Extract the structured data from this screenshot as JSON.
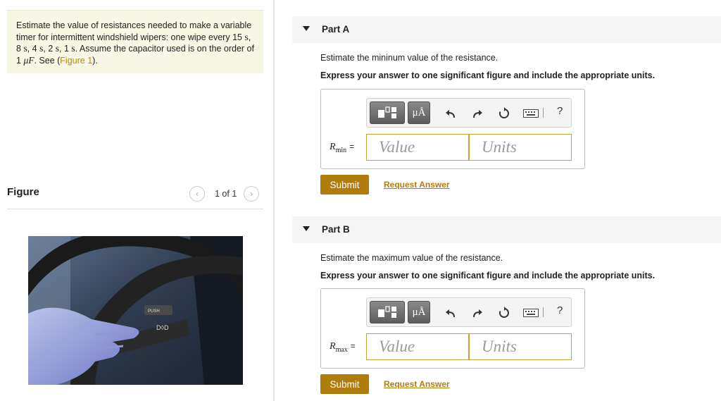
{
  "problem": {
    "text_1": "Estimate the value of resistances needed to make a variable timer for intermittent windshield wipers: one wipe every 15",
    "unit_s": "s",
    "v2": "8",
    "v3": "4",
    "v4": "2",
    "v5": "1",
    "text_2": ". Assume the capacitor used is on the order of 1",
    "unit_uF": "μF",
    "text_3": ". See (",
    "figure_link": "Figure 1",
    "text_4": ")."
  },
  "figure": {
    "title": "Figure",
    "pager": "1 of 1",
    "prev_glyph": "‹",
    "next_glyph": "›"
  },
  "toolbar": {
    "mu_a_label": "μÅ",
    "help_label": "?",
    "icons": [
      "templates-icon",
      "mu-a-icon",
      "undo-icon",
      "redo-icon",
      "reset-icon",
      "keyboard-icon",
      "help-icon"
    ]
  },
  "parts": [
    {
      "title": "Part A",
      "question": "Estimate the mininum value of the resistance.",
      "instruction": "Express your answer to one significant figure and include the appropriate units.",
      "var_symbol": "R",
      "var_sub": "min",
      "eq": "=",
      "value_placeholder": "Value",
      "units_placeholder": "Units",
      "submit_label": "Submit",
      "request_label": "Request Answer"
    },
    {
      "title": "Part B",
      "question": "Estimate the maximum value of the resistance.",
      "instruction": "Express your answer to one significant figure and include the appropriate units.",
      "var_symbol": "R",
      "var_sub": "max",
      "eq": "=",
      "value_placeholder": "Value",
      "units_placeholder": "Units",
      "submit_label": "Submit",
      "request_label": "Request Answer"
    }
  ],
  "colors": {
    "accent": "#b07c0c",
    "problem_bg": "#f7f7e3",
    "input_border": "#c7a23a",
    "part_header_bg": "#f6f6f6"
  }
}
